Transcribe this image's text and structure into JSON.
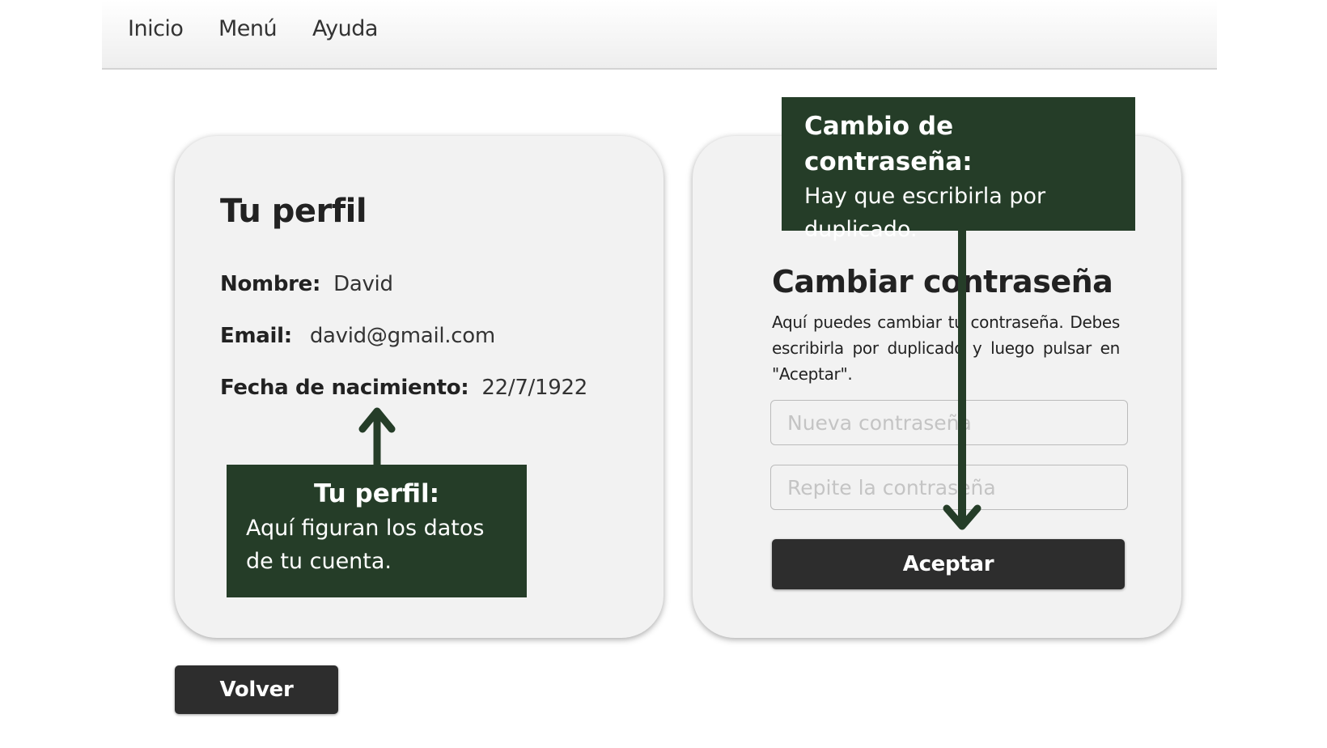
{
  "nav": {
    "items": [
      "Inicio",
      "Menú",
      "Ayuda"
    ]
  },
  "profile": {
    "title": "Tu perfil",
    "fields": [
      {
        "label": "Nombre:",
        "value": "David"
      },
      {
        "label": "Email:",
        "value": "david@gmail.com"
      },
      {
        "label": "Fecha de nacimiento:",
        "value": "22/7/1922"
      }
    ]
  },
  "password": {
    "title": "Cambiar contraseña",
    "description": "Aquí puedes cambiar tu contraseña. Debes escribirla por duplicado y luego pulsar en \"Aceptar\".",
    "new_placeholder": "Nueva contraseña",
    "repeat_placeholder": "Repite la contraseña",
    "accept_label": "Aceptar"
  },
  "back_label": "Volver",
  "annotations": {
    "profile": {
      "title": "Tu perfil:",
      "text": "Aquí figuran los datos de tu cuenta."
    },
    "password": {
      "title": "Cambio de contraseña:",
      "text": "Hay que escribirla por duplicado."
    }
  },
  "colors": {
    "annotation_bg": "#253d28",
    "button_bg": "#2d2d2d",
    "card_bg": "#f2f2f2"
  }
}
